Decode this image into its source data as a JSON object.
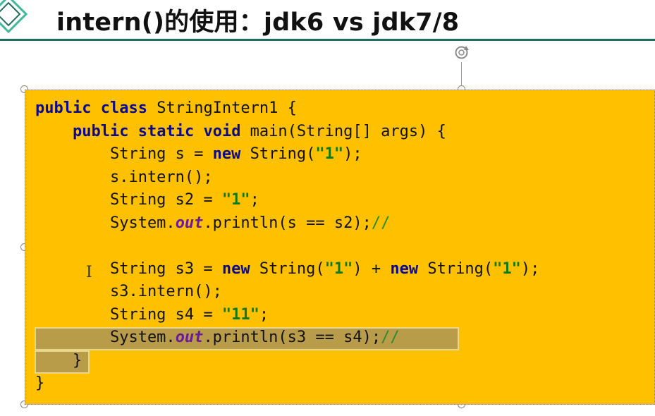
{
  "slide": {
    "title": "intern()的使用：jdk6 vs jdk7/8"
  },
  "code": {
    "lines": [
      [
        {
          "t": "public",
          "c": "kw"
        },
        {
          "t": " "
        },
        {
          "t": "class",
          "c": "kw"
        },
        {
          "t": " StringIntern1 {"
        }
      ],
      [
        {
          "t": "    "
        },
        {
          "t": "public",
          "c": "kw"
        },
        {
          "t": " "
        },
        {
          "t": "static",
          "c": "kw"
        },
        {
          "t": " "
        },
        {
          "t": "void",
          "c": "kw"
        },
        {
          "t": " main(String[] args) {"
        }
      ],
      [
        {
          "t": "        String s = "
        },
        {
          "t": "new",
          "c": "kw"
        },
        {
          "t": " String("
        },
        {
          "t": "\"1\"",
          "c": "str"
        },
        {
          "t": ");"
        }
      ],
      [
        {
          "t": "        s.intern();"
        }
      ],
      [
        {
          "t": "        String s2 = "
        },
        {
          "t": "\"1\"",
          "c": "str"
        },
        {
          "t": ";"
        }
      ],
      [
        {
          "t": "        System."
        },
        {
          "t": "out",
          "c": "fld"
        },
        {
          "t": ".println(s == s2);"
        },
        {
          "t": "//",
          "c": "cmt"
        }
      ],
      [
        {
          "t": ""
        }
      ],
      [
        {
          "t": "        String s3 = "
        },
        {
          "t": "new",
          "c": "kw"
        },
        {
          "t": " String("
        },
        {
          "t": "\"1\"",
          "c": "str"
        },
        {
          "t": ") + "
        },
        {
          "t": "new",
          "c": "kw"
        },
        {
          "t": " String("
        },
        {
          "t": "\"1\"",
          "c": "str"
        },
        {
          "t": ");"
        }
      ],
      [
        {
          "t": "        s3.intern();"
        }
      ],
      [
        {
          "t": "        String s4 = "
        },
        {
          "t": "\"11\"",
          "c": "str"
        },
        {
          "t": ";"
        }
      ],
      [
        {
          "t": "        System."
        },
        {
          "t": "out",
          "c": "fld"
        },
        {
          "t": ".println(s3 == s4);"
        },
        {
          "t": "//",
          "c": "cmt"
        }
      ],
      [
        {
          "t": "    }"
        }
      ],
      [
        {
          "t": "}"
        }
      ]
    ]
  },
  "colors": {
    "box_fill": "#ffc000",
    "keyword": "#0a0a8a",
    "string": "#0f7a12",
    "field": "#6a1b9a",
    "title_rule": "#1f6d5e"
  },
  "icons": {
    "title": "diamond-icon",
    "rotate": "rotate-handle-icon",
    "cursor": "text-cursor-icon"
  }
}
